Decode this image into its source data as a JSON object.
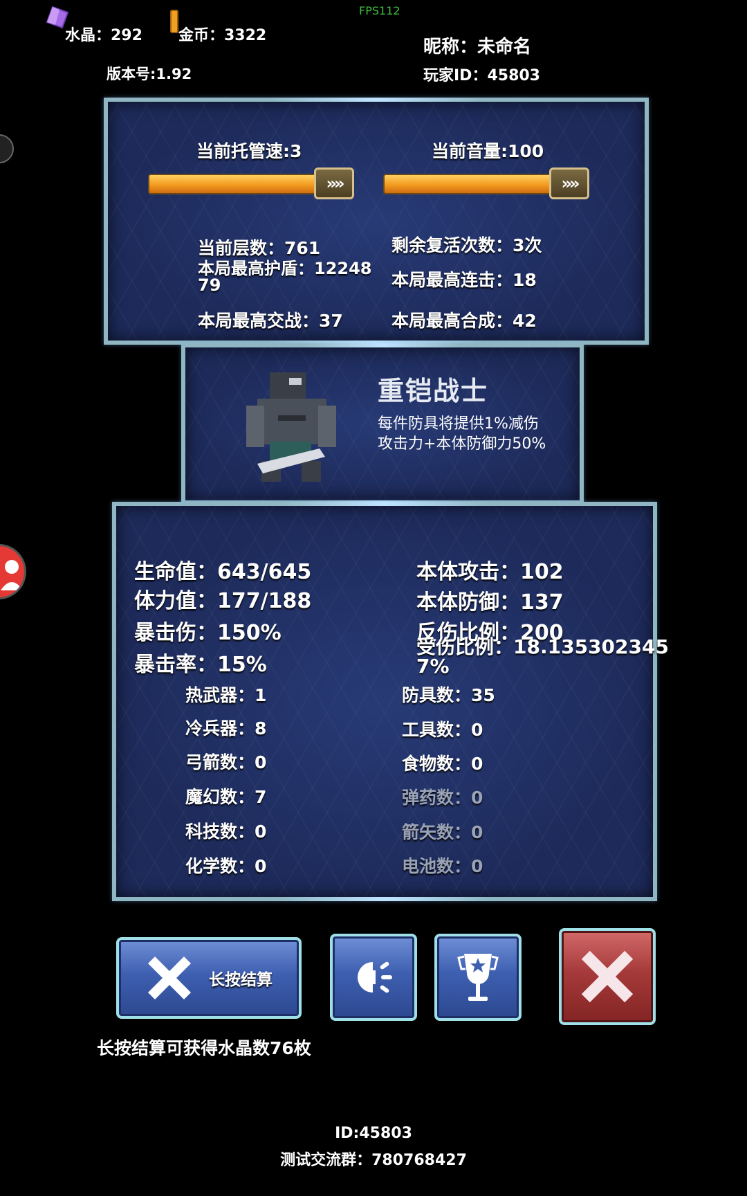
{
  "header": {
    "fps": "FPS112",
    "crystal": "水晶：292",
    "gold": "金币：3322",
    "version": "版本号:1.92",
    "nickname": "昵称：未命名",
    "player_id": "玩家ID：45803"
  },
  "settings": {
    "speed_label": "当前托管速:3",
    "volume_label": "当前音量:100",
    "handle_glyph": "»»"
  },
  "run_stats": {
    "floor": "当前层数：761",
    "revives": "剩余复活次数：3次",
    "max_shield": "本局最高护盾：12248\n79",
    "max_combo": "本局最高连击：18",
    "max_battle": "本局最高交战：37",
    "max_merge": "本局最高合成：42"
  },
  "hero": {
    "name": "重铠战士",
    "desc_1": "每件防具将提供1%减伤",
    "desc_2": "攻击力+本体防御力50%"
  },
  "attributes": {
    "hp": "生命值：643/645",
    "stamina": "体力值：177/188",
    "crit_dmg": "暴击伤：150%",
    "crit_rate": "暴击率：15%",
    "base_atk": "本体攻击：102",
    "base_def": "本体防御：137",
    "reflect": "反伤比例：200",
    "dmg_taken": "受伤比例：18.135302345\n7%"
  },
  "inventory": {
    "firearms": "热武器：1",
    "melee": "冷兵器：8",
    "bows": "弓箭数：0",
    "magic": "魔幻数：7",
    "tech": "科技数：0",
    "chem": "化学数：0",
    "armor": "防具数：35",
    "tools": "工具数：0",
    "food": "食物数：0",
    "ammo": "弹药数：0",
    "arrows": "箭矢数：0",
    "batteries": "电池数：0"
  },
  "actions": {
    "settle_label": "长按结算",
    "settle_hint": "长按结算可获得水晶数76枚"
  },
  "footer": {
    "id": "ID:45803",
    "group": "测试交流群：780768427"
  },
  "colors": {
    "panel_border": "#8fb6c2",
    "panel_bg": "#1d2a5a",
    "slider_orange": "#f29a1f",
    "button_blue": "#3e5fb0",
    "button_red": "#a63a3a",
    "fps_green": "#3fbf3f"
  },
  "icons": [
    "crystal-icon",
    "coin-icon",
    "close-x-icon",
    "light-icon",
    "trophy-icon",
    "avatar-icon"
  ],
  "sliders": {
    "speed_fill": 1.0,
    "volume_fill": 1.0
  }
}
